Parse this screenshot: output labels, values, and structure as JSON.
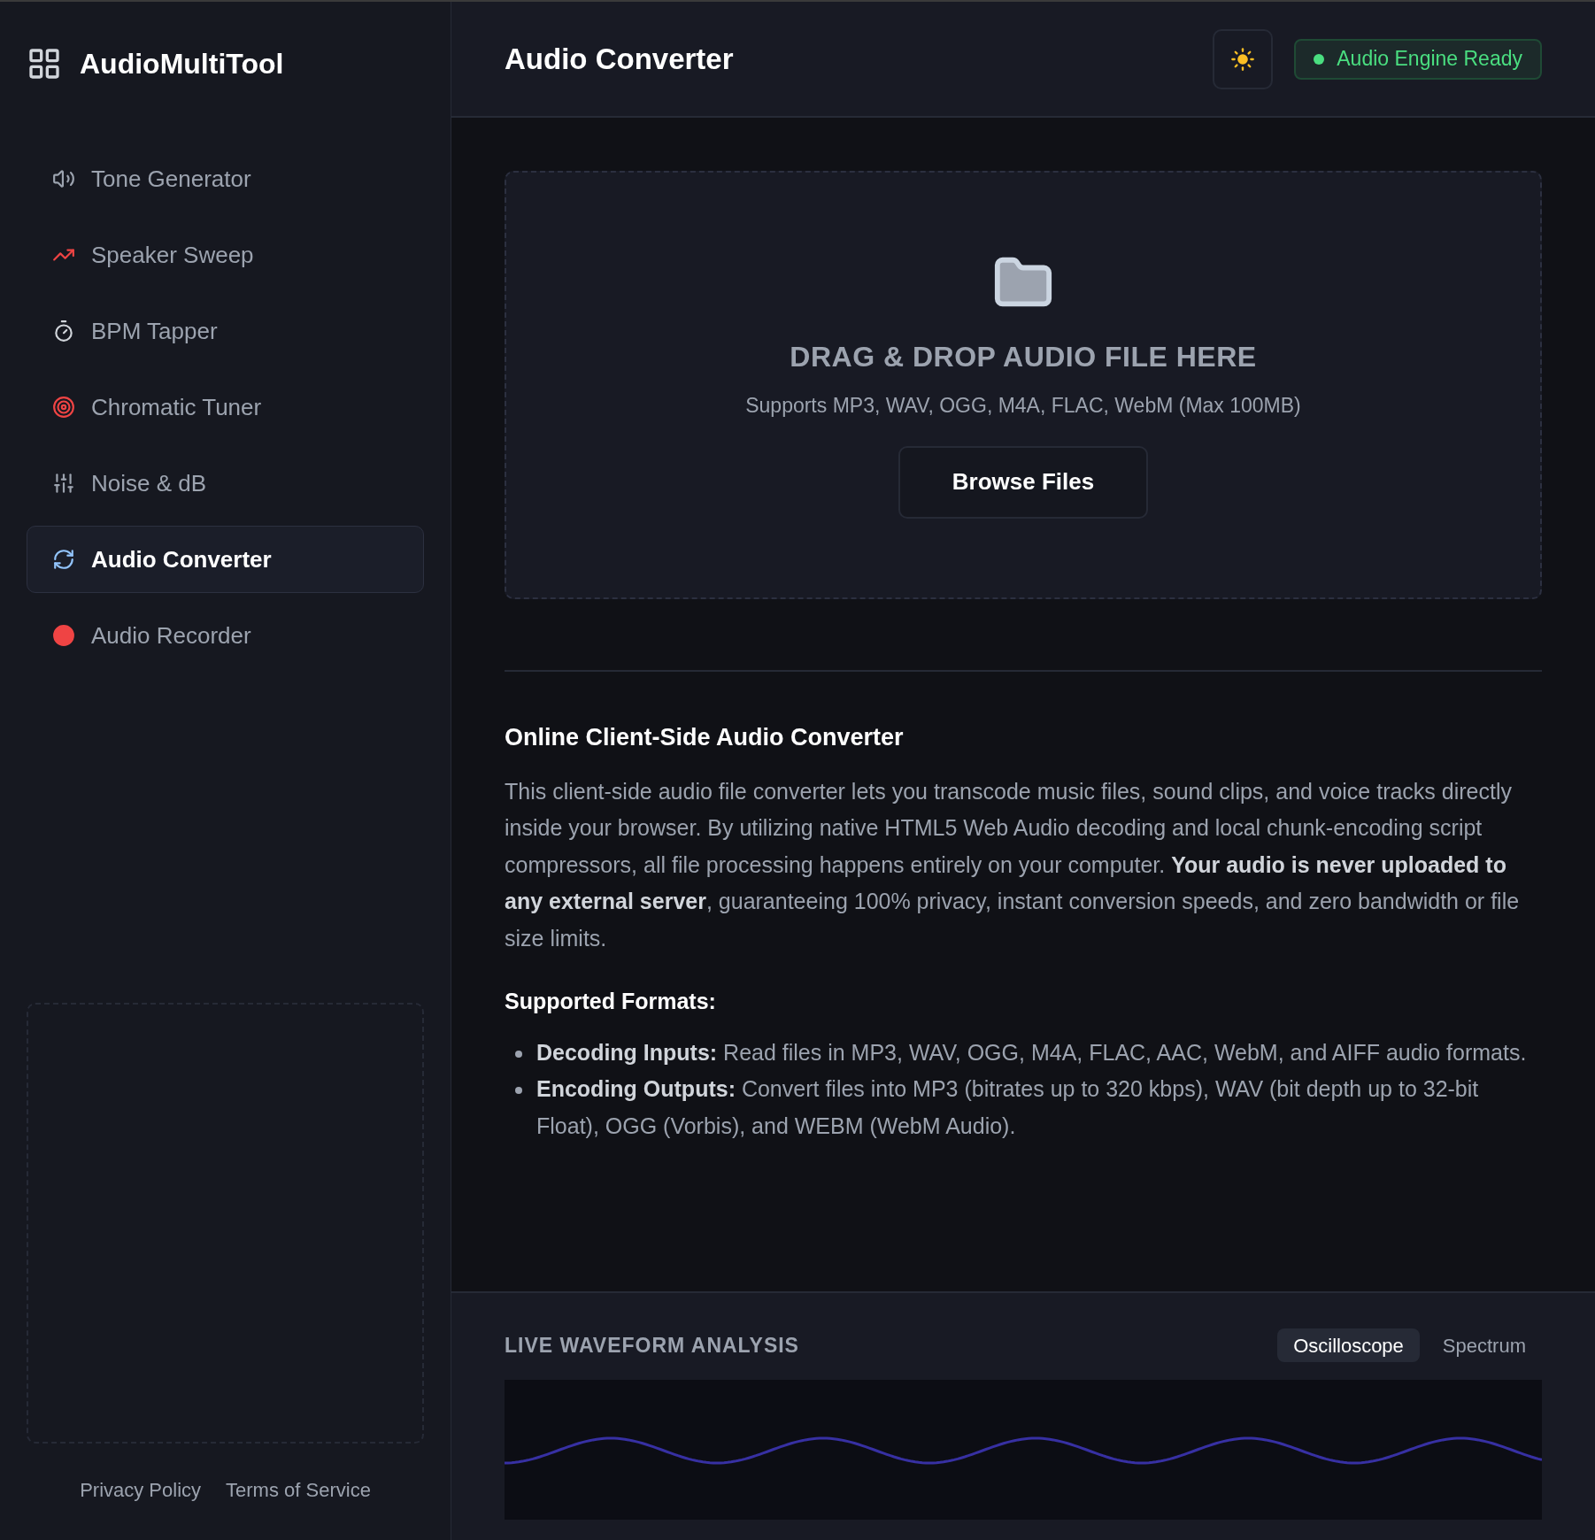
{
  "sidebar": {
    "logo": "AudioMultiTool",
    "items": [
      {
        "label": "Tone Generator",
        "selected": false
      },
      {
        "label": "Speaker Sweep",
        "selected": false
      },
      {
        "label": "BPM Tapper",
        "selected": false
      },
      {
        "label": "Chromatic Tuner",
        "selected": false
      },
      {
        "label": "Noise & dB",
        "selected": false
      },
      {
        "label": "Audio Converter",
        "selected": true
      },
      {
        "label": "Audio Recorder",
        "selected": false
      }
    ],
    "footer_links": [
      "Privacy Policy",
      "Terms of Service"
    ]
  },
  "header": {
    "title": "Audio Converter",
    "status": {
      "label": "Audio Engine Ready",
      "color": "#4ade80"
    }
  },
  "dropzone": {
    "title": "DRAG & DROP AUDIO FILE HERE",
    "subtitle": "Supports MP3, WAV, OGG, M4A, FLAC, WebM (Max 100MB)",
    "button": "Browse Files"
  },
  "article": {
    "heading": "Online Client-Side Audio Converter",
    "paragraph": "This client-side audio file converter lets you transcode music files, sound clips, and voice tracks directly inside your browser. By utilizing native HTML5 Web Audio decoding and local chunk-encoding script compressors, all file processing happens entirely on your computer. **Your audio is never uploaded to any external server**, guaranteeing 100% privacy, instant conversion speeds, and zero bandwidth or file size limits.",
    "formats_heading": "Supported Formats:",
    "formats": [
      "**Decoding Inputs:** Read files in MP3, WAV, OGG, M4A, FLAC, AAC, WebM, and AIFF audio formats.",
      "**Encoding Outputs:** Convert files into MP3 (bitrates up to 320 kbps), WAV (bit depth up to 32-bit Float), OGG (Vorbis), and WEBM (WebM Audio)."
    ]
  },
  "analysis": {
    "title": "LIVE WAVEFORM ANALYSIS",
    "tabs": [
      {
        "label": "Oscilloscope",
        "selected": true
      },
      {
        "label": "Spectrum",
        "selected": false
      }
    ]
  }
}
